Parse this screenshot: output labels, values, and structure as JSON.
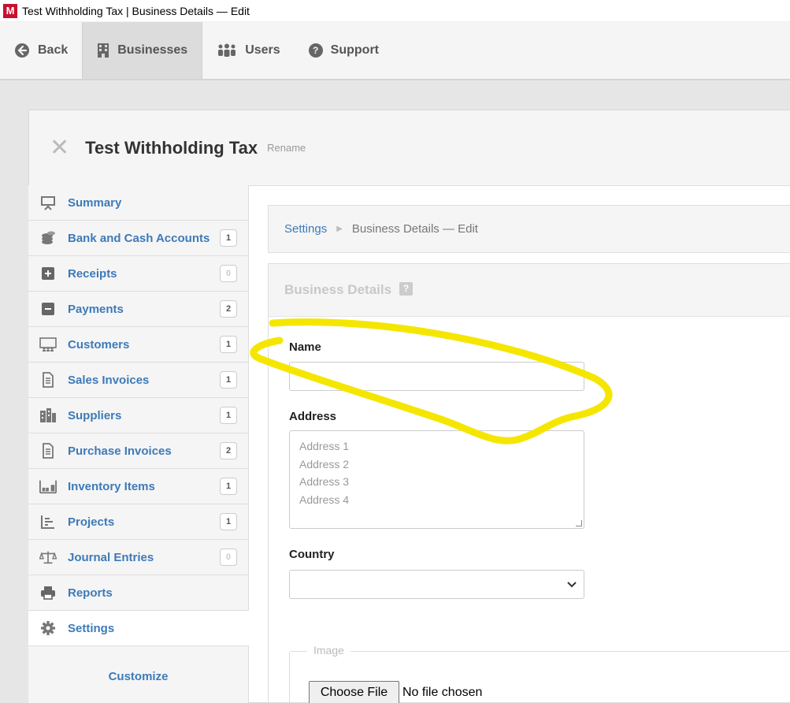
{
  "window": {
    "app_letter": "M",
    "title": "Test Withholding Tax | Business Details — Edit"
  },
  "topnav": {
    "items": [
      {
        "label": "Back",
        "icon": "back-circle-icon"
      },
      {
        "label": "Businesses",
        "icon": "building-icon",
        "active": true
      },
      {
        "label": "Users",
        "icon": "users-icon"
      },
      {
        "label": "Support",
        "icon": "question-circle-icon"
      }
    ]
  },
  "business": {
    "name": "Test Withholding Tax",
    "rename_label": "Rename",
    "close_glyph": "✕"
  },
  "sidebar": {
    "items": [
      {
        "label": "Summary",
        "icon": "presentation-icon",
        "badge": ""
      },
      {
        "label": "Bank and Cash Accounts",
        "icon": "coins-icon",
        "badge": "1"
      },
      {
        "label": "Receipts",
        "icon": "plus-square-icon",
        "badge": "0"
      },
      {
        "label": "Payments",
        "icon": "minus-square-icon",
        "badge": "2"
      },
      {
        "label": "Customers",
        "icon": "customers-icon",
        "badge": "1"
      },
      {
        "label": "Sales Invoices",
        "icon": "document-icon",
        "badge": "1"
      },
      {
        "label": "Suppliers",
        "icon": "suppliers-icon",
        "badge": "1"
      },
      {
        "label": "Purchase Invoices",
        "icon": "document-icon",
        "badge": "2"
      },
      {
        "label": "Inventory Items",
        "icon": "inventory-icon",
        "badge": "1"
      },
      {
        "label": "Projects",
        "icon": "projects-icon",
        "badge": "1"
      },
      {
        "label": "Journal Entries",
        "icon": "scales-icon",
        "badge": "0"
      },
      {
        "label": "Reports",
        "icon": "printer-icon",
        "badge": ""
      },
      {
        "label": "Settings",
        "icon": "gear-icon",
        "badge": "",
        "active": true
      }
    ],
    "customize_label": "Customize"
  },
  "breadcrumb": {
    "parent": "Settings",
    "current": "Business Details — Edit"
  },
  "form": {
    "title": "Business Details",
    "help_glyph": "?",
    "name_label": "Name",
    "name_value": "",
    "address_label": "Address",
    "address_placeholder_lines": [
      "Address 1",
      "Address 2",
      "Address 3",
      "Address 4"
    ],
    "country_label": "Country",
    "country_value": "",
    "image_legend": "Image",
    "choose_file_label": "Choose File",
    "file_status": "No file chosen"
  },
  "colors": {
    "link": "#3d7ab8",
    "annotation_highlight": "#f5e600"
  }
}
